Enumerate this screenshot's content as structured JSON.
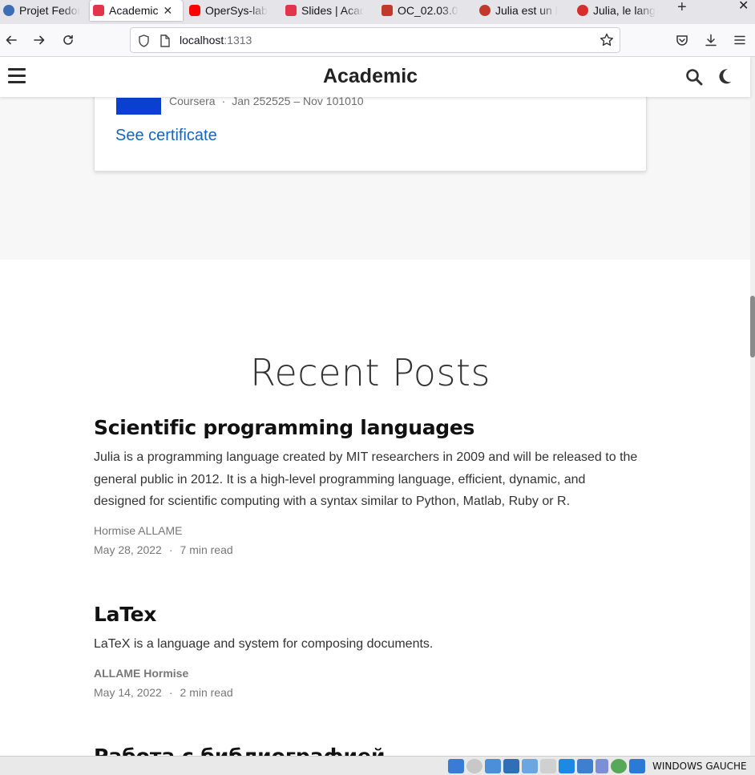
{
  "browser": {
    "tabs": [
      {
        "label": "Projet Fedora",
        "favicon_color": "#3c6eb4",
        "active": false
      },
      {
        "label": "Academic",
        "favicon_color": "#e2354b",
        "active": true
      },
      {
        "label": "OperSys-lab",
        "favicon_color": "#ff0000",
        "active": false
      },
      {
        "label": "Slides | Academic",
        "favicon_color": "#e2354b",
        "active": false
      },
      {
        "label": "OC_02.03.0",
        "favicon_color": "#c0392b",
        "active": false
      },
      {
        "label": "Julia est un l",
        "favicon_color": "#c0392b",
        "active": false
      },
      {
        "label": "Julia, le lang",
        "favicon_color": "#d62d2d",
        "active": false
      }
    ],
    "new_tab_symbol": "+",
    "window_close_symbol": "✕",
    "tab_close_symbol": "✕",
    "url_host": "localhost",
    "url_port": ":1313"
  },
  "site": {
    "title": "Academic"
  },
  "certificate": {
    "issuer": "Coursera",
    "separator": "·",
    "dates": "Jan 252525 – Nov 101010",
    "link_label": "See certificate",
    "logo_color": "#0b3fd1"
  },
  "recent_posts": {
    "heading": "Recent Posts",
    "posts": [
      {
        "title": "Scientific programming languages",
        "summary": "Julia is a programming language created by MIT researchers in 2009 and will be released to the general public in 2012. It is a high-level programming language, efficient, dynamic, and designed for scientific computing with a syntax similar to Python, Matlab, Ruby or R.",
        "author": "Hormise ALLAME",
        "date": "May 28, 2022",
        "separator": "·",
        "read_time": "7 min read"
      },
      {
        "title": "LaTex",
        "summary": "LaTeX is a language and system for composing documents.",
        "author": "ALLAME Hormise",
        "date": "May 14, 2022",
        "separator": "·",
        "read_time": "2 min read"
      }
    ],
    "next_post_title_partial": "Работа с библиографией"
  },
  "taskbar": {
    "label": "WINDOWS GAUCHE"
  },
  "colors": {
    "link": "#1565c0",
    "grey_band": "#f7f7f7"
  }
}
